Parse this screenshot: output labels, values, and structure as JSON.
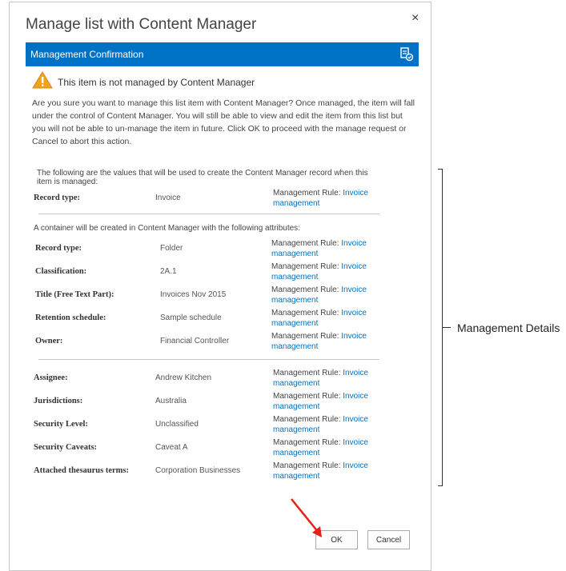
{
  "dialog": {
    "title": "Manage list with Content Manager",
    "close_label": "×"
  },
  "banner": {
    "title": "Management Confirmation",
    "icon": "records-icon",
    "color": "#0072c6"
  },
  "warning": {
    "icon": "warning-icon",
    "text": "This item is not managed by Content Manager",
    "color": "#f4a21d"
  },
  "message": "Are you sure you want to manage this list item with Content Manager? Once managed, the item will fall under the control of Content Manager. You will still be able to view and edit the item from this list but you will not be able to un-manage the item in future. Click OK to proceed with the manage request or Cancel to abort this action.",
  "record_section": {
    "intro": "The following are the values that will be used to create the Content Manager record when this item is managed:",
    "rows": [
      {
        "label": "Record type:",
        "value": "Invoice",
        "rule_prefix": "Management Rule:",
        "rule_link": "Invoice management"
      }
    ]
  },
  "container_section": {
    "intro": "A container will be created in Content Manager with the following attributes:",
    "rows": [
      {
        "label": "Record type:",
        "value": "Folder",
        "rule_prefix": "Management Rule:",
        "rule_link": "Invoice management"
      },
      {
        "label": "Classification:",
        "value": "2A.1",
        "rule_prefix": "Management Rule:",
        "rule_link": "Invoice management"
      },
      {
        "label": "Title (Free Text Part):",
        "value": "Invoices Nov 2015",
        "rule_prefix": "Management Rule:",
        "rule_link": "Invoice management"
      },
      {
        "label": "Retention schedule:",
        "value": "Sample schedule",
        "rule_prefix": "Management Rule:",
        "rule_link": "Invoice management"
      },
      {
        "label": "Owner:",
        "value": "Financial Controller",
        "rule_prefix": "Management Rule:",
        "rule_link": "Invoice management"
      }
    ]
  },
  "other_section": {
    "rows": [
      {
        "label": "Assignee:",
        "value": "Andrew Kitchen",
        "rule_prefix": "Management Rule:",
        "rule_link": "Invoice management"
      },
      {
        "label": "Jurisdictions:",
        "value": "Australia",
        "rule_prefix": "Management Rule:",
        "rule_link": "Invoice management"
      },
      {
        "label": "Security Level:",
        "value": "Unclassified",
        "rule_prefix": "Management Rule:",
        "rule_link": "Invoice management"
      },
      {
        "label": "Security Caveats:",
        "value": "Caveat A",
        "rule_prefix": "Management Rule:",
        "rule_link": "Invoice management"
      },
      {
        "label": "Attached thesaurus terms:",
        "value": "Corporation Businesses",
        "rule_prefix": "Management Rule:",
        "rule_link": "Invoice management"
      }
    ]
  },
  "buttons": {
    "ok": "OK",
    "cancel": "Cancel"
  },
  "annotation": {
    "callout": "Management Details",
    "arrow_color": "#e8201a"
  }
}
